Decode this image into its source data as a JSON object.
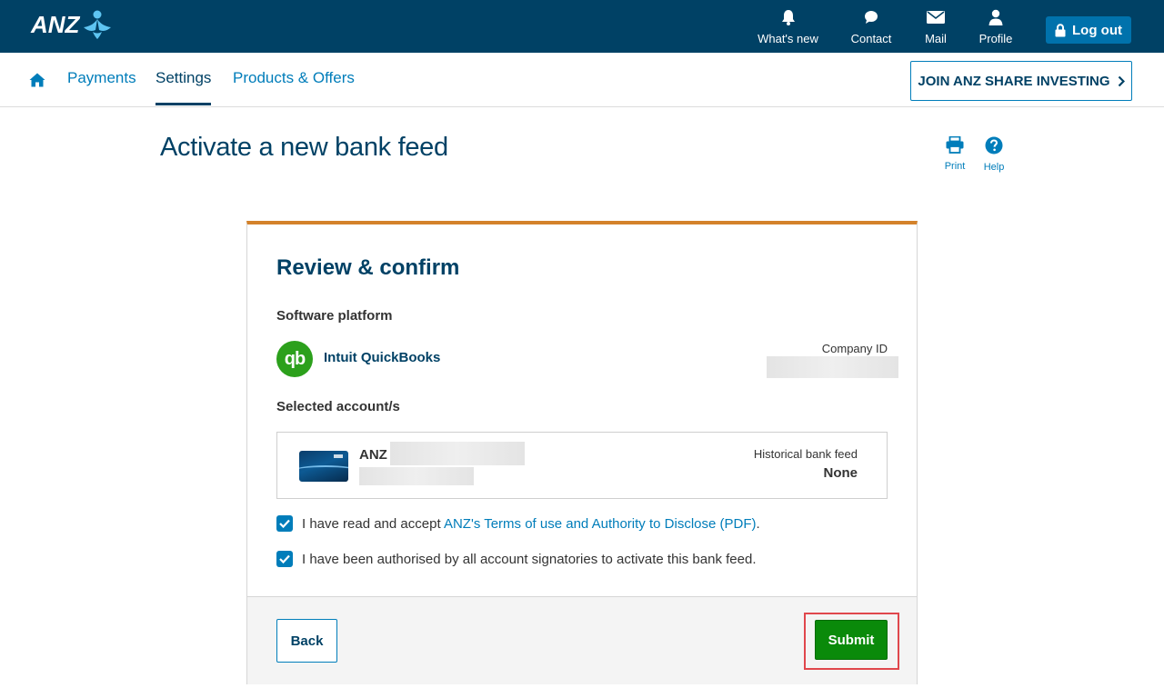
{
  "brand": {
    "logo_text": "ANZ"
  },
  "topbar": {
    "items": [
      {
        "label": "What's new",
        "icon": "bell-icon"
      },
      {
        "label": "Contact",
        "icon": "chat-bubble-icon"
      },
      {
        "label": "Mail",
        "icon": "envelope-icon"
      },
      {
        "label": "Profile",
        "icon": "person-icon"
      }
    ],
    "logout_label": "Log out"
  },
  "subnav": {
    "home_icon": "home-icon",
    "links": [
      "Payments",
      "Settings",
      "Products & Offers"
    ],
    "active": "Settings",
    "join_label": "JOIN ANZ SHARE INVESTING"
  },
  "page": {
    "title": "Activate a new bank feed",
    "tools": {
      "print_label": "Print",
      "help_label": "Help"
    }
  },
  "card": {
    "title": "Review & confirm",
    "software_label": "Software platform",
    "platform_name": "Intuit QuickBooks",
    "platform_logo_text": "qb",
    "company_id_label": "Company ID",
    "accounts_label": "Selected account/s",
    "account": {
      "name": "ANZ",
      "historical_label": "Historical bank feed",
      "historical_value": "None"
    },
    "terms": {
      "prefix": "I have read and accept ",
      "link": "ANZ's Terms of use and Authority to Disclose (PDF)",
      "suffix": ".",
      "checked": true
    },
    "authorised": {
      "text": "I have been authorised by all account signatories to activate this bank feed.",
      "checked": true
    },
    "back_label": "Back",
    "submit_label": "Submit"
  },
  "colors": {
    "header_bg": "#004165",
    "accent_blue": "#007dba",
    "card_top_border": "#d4822a",
    "submit_green": "#0a8a0a",
    "highlight_red": "#e0474c"
  }
}
